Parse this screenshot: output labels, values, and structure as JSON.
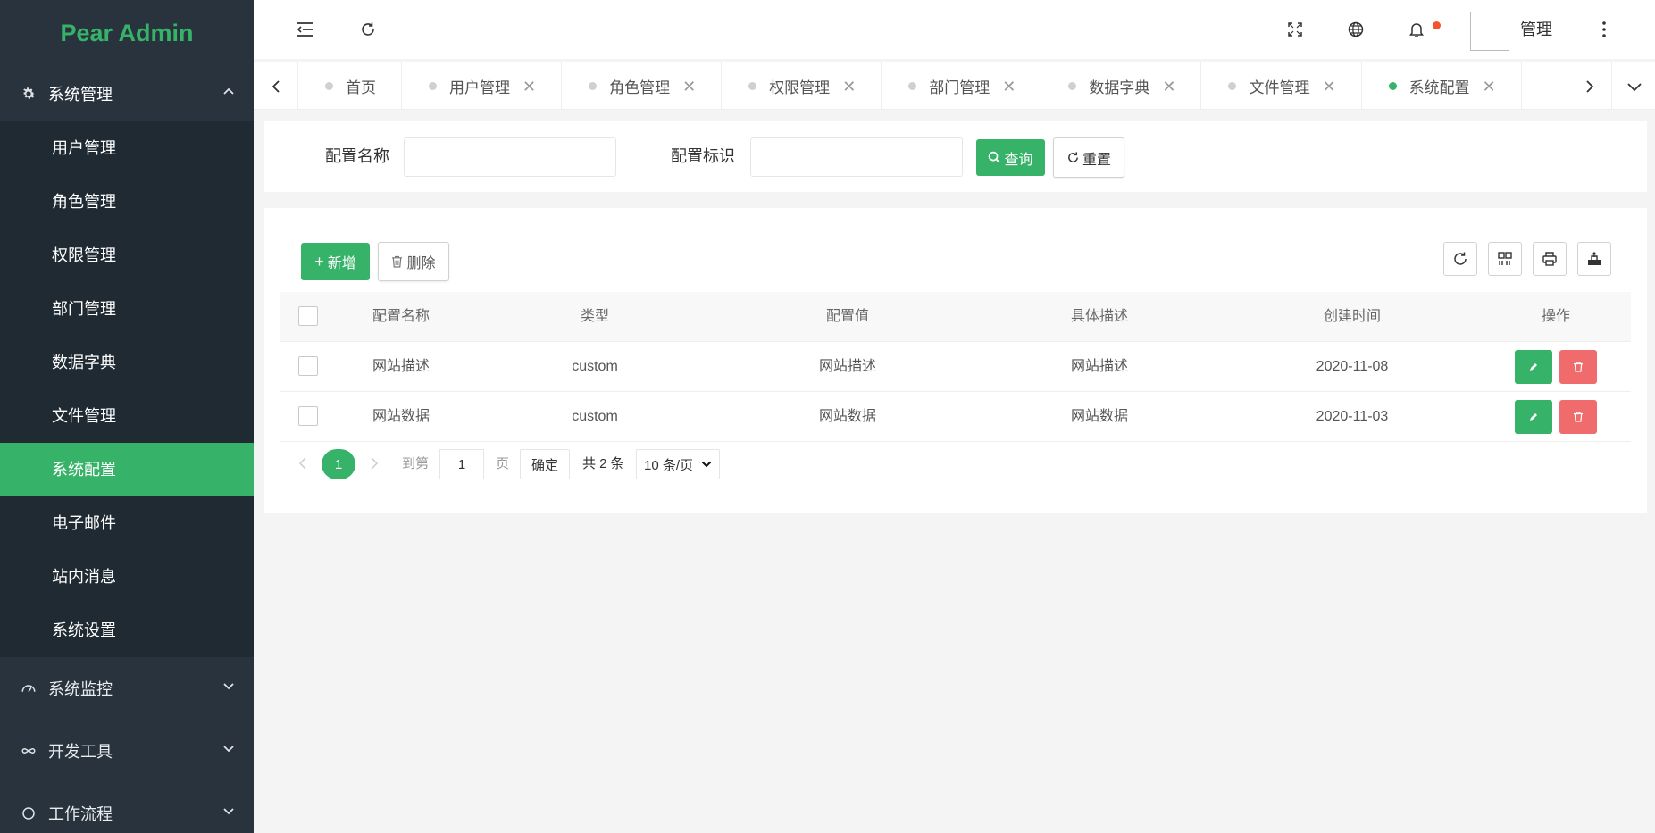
{
  "app": {
    "logo": "Pear Admin"
  },
  "sidebar": {
    "open_group": {
      "label": "系统管理"
    },
    "items": [
      {
        "label": "用户管理",
        "active": false
      },
      {
        "label": "角色管理",
        "active": false
      },
      {
        "label": "权限管理",
        "active": false
      },
      {
        "label": "部门管理",
        "active": false
      },
      {
        "label": "数据字典",
        "active": false
      },
      {
        "label": "文件管理",
        "active": false
      },
      {
        "label": "系统配置",
        "active": true
      },
      {
        "label": "电子邮件",
        "active": false
      },
      {
        "label": "站内消息",
        "active": false
      },
      {
        "label": "系统设置",
        "active": false
      }
    ],
    "groups": [
      {
        "label": "系统监控"
      },
      {
        "label": "开发工具"
      },
      {
        "label": "工作流程"
      }
    ]
  },
  "header": {
    "user_name": "管理"
  },
  "tabs": [
    {
      "label": "首页",
      "closable": false
    },
    {
      "label": "用户管理",
      "closable": true
    },
    {
      "label": "角色管理",
      "closable": true
    },
    {
      "label": "权限管理",
      "closable": true
    },
    {
      "label": "部门管理",
      "closable": true
    },
    {
      "label": "数据字典",
      "closable": true
    },
    {
      "label": "文件管理",
      "closable": true
    },
    {
      "label": "系统配置",
      "closable": true,
      "active": true
    }
  ],
  "search": {
    "name_label": "配置名称",
    "name_value": "",
    "code_label": "配置标识",
    "code_value": "",
    "query_label": "查询",
    "reset_label": "重置"
  },
  "toolbar": {
    "add_label": "新增",
    "delete_label": "删除"
  },
  "table": {
    "headers": [
      "配置名称",
      "类型",
      "配置值",
      "具体描述",
      "创建时间",
      "操作"
    ],
    "rows": [
      [
        "网站描述",
        "custom",
        "网站描述",
        "网站描述",
        "2020-11-08"
      ],
      [
        "网站数据",
        "custom",
        "网站数据",
        "网站数据",
        "2020-11-03"
      ]
    ]
  },
  "pager": {
    "current": "1",
    "goto_label": "到第",
    "goto_value": "1",
    "page_suffix": "页",
    "confirm_label": "确定",
    "total_label": "共 2 条",
    "page_size": "10 条/页"
  },
  "colors": {
    "primary": "#36b368",
    "danger": "#f06c6c",
    "sidebar_bg": "#28333e",
    "submenu_bg": "#1f2a33",
    "notify": "#f2562a"
  }
}
